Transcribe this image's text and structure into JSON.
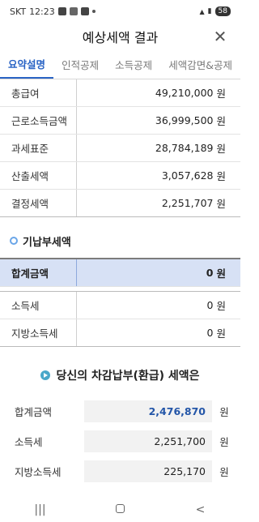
{
  "status_bar": {
    "carrier": "SKT",
    "time": "12:23",
    "battery": "58"
  },
  "header": {
    "title": "예상세액 결과"
  },
  "tabs": [
    {
      "label": "요약설명",
      "active": true
    },
    {
      "label": "인적공제",
      "active": false
    },
    {
      "label": "소득공제",
      "active": false
    },
    {
      "label": "세액감면&공제",
      "active": false
    }
  ],
  "summary_rows": [
    {
      "label": "총급여",
      "value": "49,210,000",
      "unit": "원"
    },
    {
      "label": "근로소득금액",
      "value": "36,999,500",
      "unit": "원"
    },
    {
      "label": "과세표준",
      "value": "28,784,189",
      "unit": "원"
    },
    {
      "label": "산출세액",
      "value": "3,057,628",
      "unit": "원"
    },
    {
      "label": "결정세액",
      "value": "2,251,707",
      "unit": "원"
    }
  ],
  "prepaid": {
    "heading": "기납부세액",
    "total": {
      "label": "합계금액",
      "value": "0",
      "unit": "원"
    },
    "rows": [
      {
        "label": "소득세",
        "value": "0",
        "unit": "원"
      },
      {
        "label": "지방소득세",
        "value": "0",
        "unit": "원"
      }
    ]
  },
  "result": {
    "heading": "당신의 차감납부(환급) 세액은",
    "rows": [
      {
        "label": "합계금액",
        "value": "2,476,870",
        "unit": "원"
      },
      {
        "label": "소득세",
        "value": "2,251,700",
        "unit": "원"
      },
      {
        "label": "지방소득세",
        "value": "225,170",
        "unit": "원"
      }
    ]
  },
  "colors": {
    "accent": "#2a64c5",
    "highlight_row": "#d7e1f5",
    "result_value": "#2456a8"
  }
}
